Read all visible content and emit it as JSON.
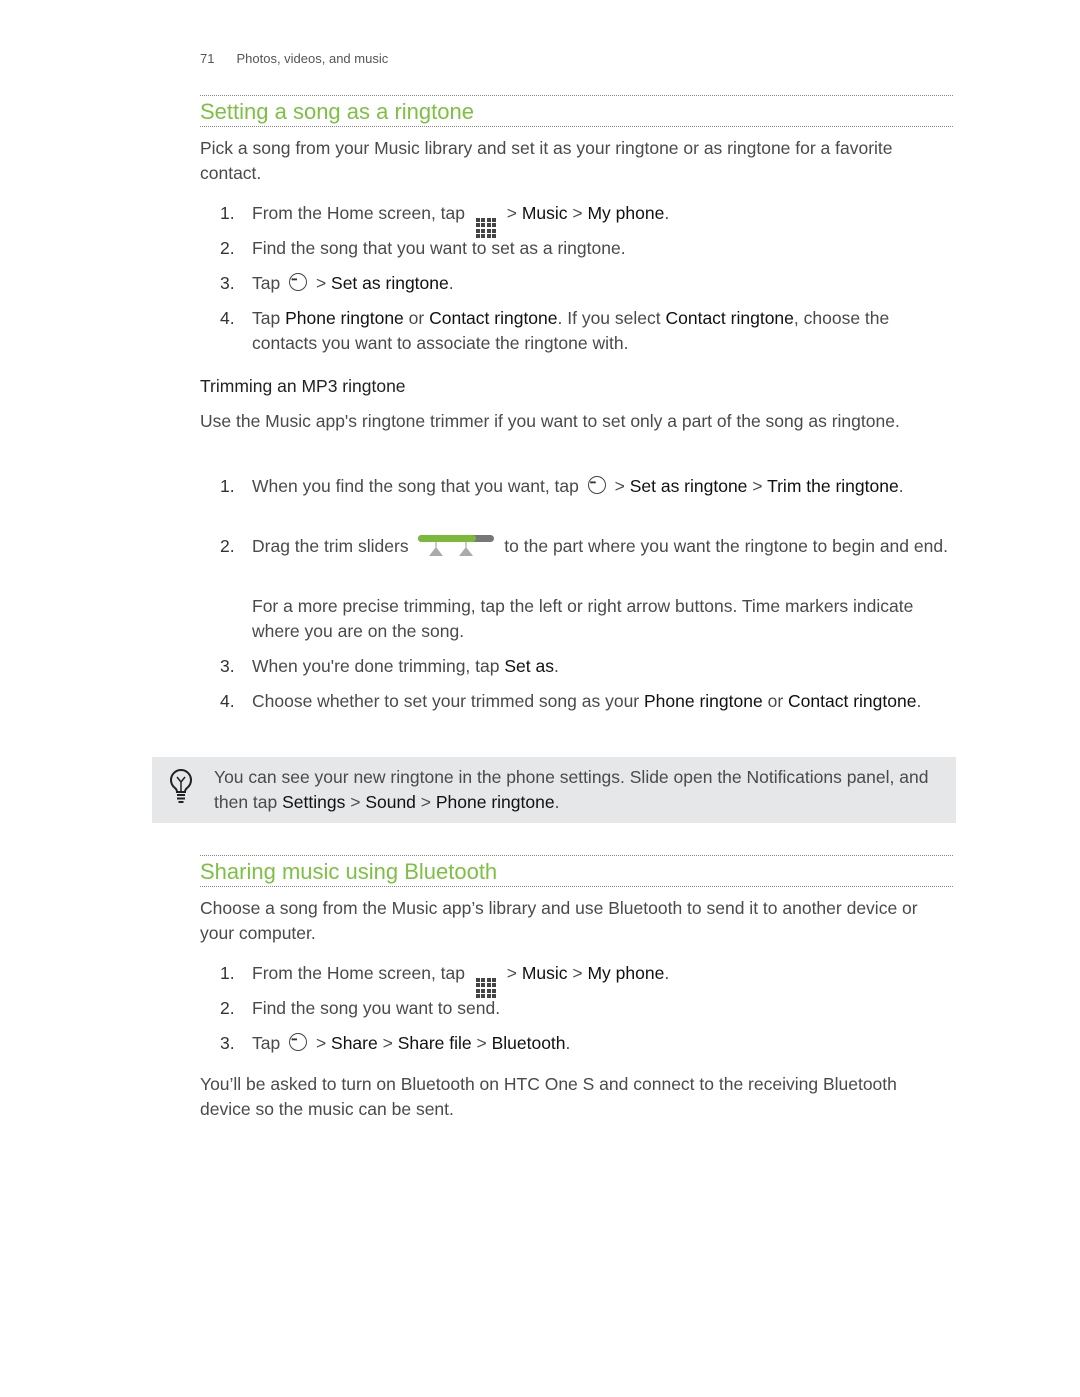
{
  "header": {
    "page_number": "71",
    "chapter": "Photos, videos, and music"
  },
  "colors": {
    "heading": "#7dc142",
    "tip_background": "#e6e7e8"
  },
  "section1": {
    "title": "Setting a song as a ringtone",
    "intro": "Pick a song from your Music library and set it as your ringtone or as ringtone for a favorite contact.",
    "steps": [
      {
        "n": "1.",
        "runs": [
          {
            "t": "From the Home screen, tap "
          },
          {
            "icon": "all-apps-grid-icon"
          },
          {
            "t": " > "
          },
          {
            "t": "Music",
            "b": true
          },
          {
            "t": " > "
          },
          {
            "t": "My phone",
            "b": true
          },
          {
            "t": "."
          }
        ]
      },
      {
        "n": "2.",
        "runs": [
          {
            "t": "Find the song that you want to set as a ringtone."
          }
        ]
      },
      {
        "n": "3.",
        "runs": [
          {
            "t": "Tap "
          },
          {
            "icon": "more-options-icon"
          },
          {
            "t": " > "
          },
          {
            "t": "Set as ringtone",
            "b": true
          },
          {
            "t": "."
          }
        ]
      },
      {
        "n": "4.",
        "runs": [
          {
            "t": "Tap "
          },
          {
            "t": "Phone ringtone",
            "b": true
          },
          {
            "t": " or "
          },
          {
            "t": "Contact ringtone",
            "b": true
          },
          {
            "t": ". If you select "
          },
          {
            "t": "Contact ringtone",
            "b": true
          },
          {
            "t": ", choose the contacts you want to associate the ringtone with."
          }
        ]
      }
    ],
    "subheading": "Trimming an MP3 ringtone",
    "sub_intro": "Use the Music app's ringtone trimmer if you want to set only a part of the song as ringtone.",
    "sub_steps": [
      {
        "n": "1.",
        "runs": [
          {
            "t": "When you find the song that you want, tap "
          },
          {
            "icon": "more-options-icon"
          },
          {
            "t": " > "
          },
          {
            "t": "Set as ringtone",
            "b": true
          },
          {
            "t": " > "
          },
          {
            "t": "Trim the ringtone",
            "b": true
          },
          {
            "t": "."
          }
        ]
      },
      {
        "n": "2.",
        "runs": [
          {
            "t": "Drag the trim sliders "
          },
          {
            "icon": "trim-slider-icon"
          },
          {
            "t": " to the part where you want the ringtone to begin and end."
          }
        ]
      },
      {
        "n": "",
        "runs": [
          {
            "t": "For a more precise trimming, tap the left or right arrow buttons. Time markers indicate where you are on the song."
          }
        ]
      },
      {
        "n": "3.",
        "runs": [
          {
            "t": "When you're done trimming, tap "
          },
          {
            "t": "Set as",
            "b": true
          },
          {
            "t": "."
          }
        ]
      },
      {
        "n": "4.",
        "runs": [
          {
            "t": "Choose whether to set your trimmed song as your "
          },
          {
            "t": "Phone ringtone",
            "b": true
          },
          {
            "t": " or "
          },
          {
            "t": "Contact ringtone",
            "b": true
          },
          {
            "t": "."
          }
        ]
      }
    ],
    "tip": {
      "icon": "lightbulb-icon",
      "runs": [
        {
          "t": "You can see your new ringtone in the phone settings. Slide open the Notifications panel, and then tap "
        },
        {
          "t": "Settings",
          "b": true
        },
        {
          "t": " > "
        },
        {
          "t": "Sound",
          "b": true
        },
        {
          "t": " > "
        },
        {
          "t": "Phone ringtone",
          "b": true
        },
        {
          "t": "."
        }
      ]
    }
  },
  "section2": {
    "title": "Sharing music using Bluetooth",
    "intro": "Choose a song from the Music app’s library and use Bluetooth to send it to another device or your computer.",
    "steps": [
      {
        "n": "1.",
        "runs": [
          {
            "t": "From the Home screen, tap "
          },
          {
            "icon": "all-apps-grid-icon"
          },
          {
            "t": " > "
          },
          {
            "t": "Music",
            "b": true
          },
          {
            "t": " > "
          },
          {
            "t": "My phone",
            "b": true
          },
          {
            "t": "."
          }
        ]
      },
      {
        "n": "2.",
        "runs": [
          {
            "t": "Find the song you want to send."
          }
        ]
      },
      {
        "n": "3.",
        "runs": [
          {
            "t": "Tap "
          },
          {
            "icon": "more-options-icon"
          },
          {
            "t": " > "
          },
          {
            "t": "Share",
            "b": true
          },
          {
            "t": " > "
          },
          {
            "t": "Share file",
            "b": true
          },
          {
            "t": " > "
          },
          {
            "t": "Bluetooth",
            "b": true
          },
          {
            "t": "."
          }
        ]
      }
    ],
    "outro": "You’ll be asked to turn on Bluetooth on HTC One S and connect to the receiving Bluetooth device so the music can be sent."
  }
}
